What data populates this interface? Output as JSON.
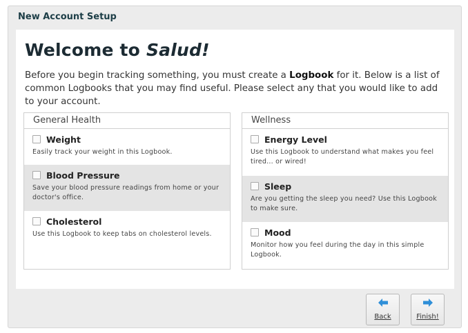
{
  "dialog": {
    "title": "New Account Setup"
  },
  "welcome": {
    "prefix": "Welcome to ",
    "app_name": "Salud!"
  },
  "intro": {
    "part1": "Before you begin tracking something, you must create a ",
    "bold": "Logbook",
    "part2": " for it. Below is a list of common Logbooks that you may find useful. Please select any that you would like to add to your account."
  },
  "columns": [
    {
      "header": "General Health",
      "items": [
        {
          "name": "Weight",
          "description": "Easily track your weight in this Logbook.",
          "checked": false
        },
        {
          "name": "Blood Pressure",
          "description": "Save your blood pressure readings from home or your doctor's office.",
          "checked": false
        },
        {
          "name": "Cholesterol",
          "description": "Use this Logbook to keep tabs on cholesterol levels.",
          "checked": false
        }
      ]
    },
    {
      "header": "Wellness",
      "items": [
        {
          "name": "Energy Level",
          "description": "Use this Logbook to understand what makes you feel tired... or wired!",
          "checked": false
        },
        {
          "name": "Sleep",
          "description": "Are you getting the sleep you need? Use this Logbook to make sure.",
          "checked": false
        },
        {
          "name": "Mood",
          "description": "Monitor how you feel during the day in this simple Logbook.",
          "checked": false
        }
      ]
    }
  ],
  "buttons": {
    "back_label": "Back",
    "back_icon": "arrow-left-icon",
    "finish_label": "Finish!",
    "finish_icon": "arrow-right-icon",
    "icon_color": "#2f8fd8"
  }
}
